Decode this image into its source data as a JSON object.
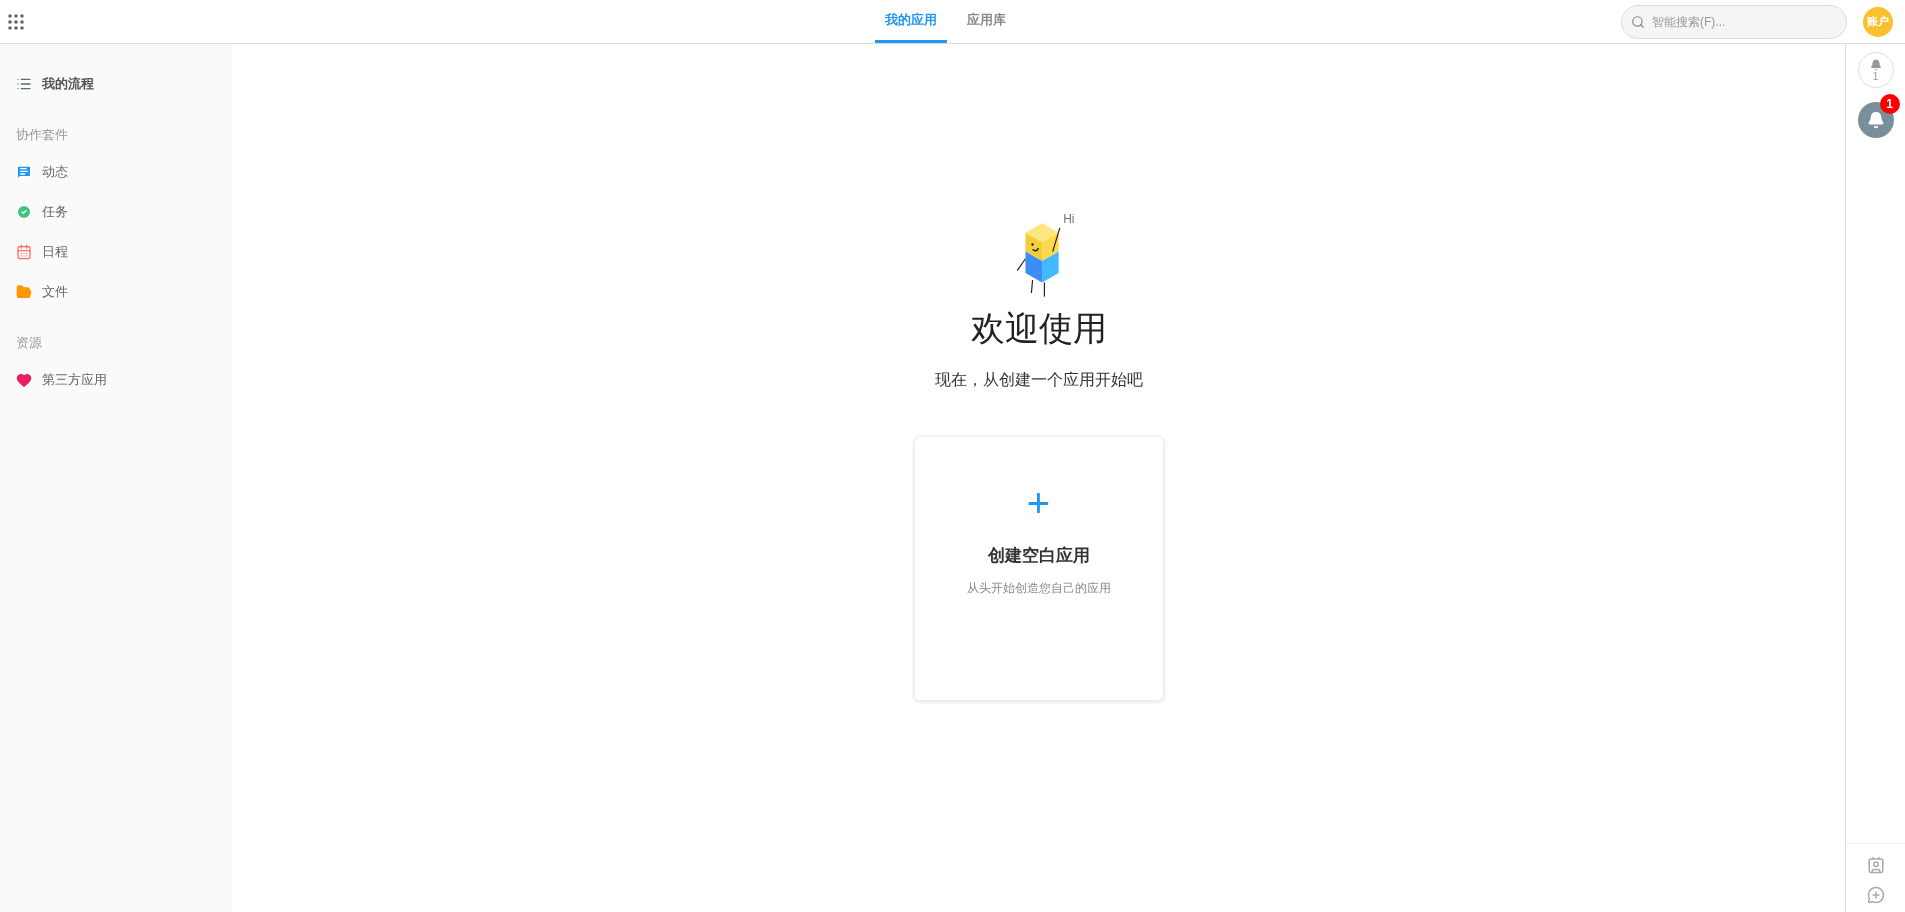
{
  "header": {
    "tabs": [
      {
        "label": "我的应用",
        "selected": true
      },
      {
        "label": "应用库",
        "selected": false
      }
    ],
    "search": {
      "placeholder": "智能搜索(F)..."
    },
    "account": "账户"
  },
  "sidebar": {
    "top_item": {
      "label": "我的流程"
    },
    "sections": [
      {
        "title": "协作套件",
        "items": [
          {
            "label": "动态"
          },
          {
            "label": "任务"
          },
          {
            "label": "日程"
          },
          {
            "label": "文件"
          }
        ]
      },
      {
        "title": "资源",
        "items": [
          {
            "label": "第三方应用"
          }
        ]
      }
    ]
  },
  "main": {
    "greeting": "Hi",
    "title": "欢迎使用",
    "subtitle": "现在，从创建一个应用开始吧",
    "card": {
      "plus": "+",
      "title": "创建空白应用",
      "description": "从头开始创造您自己的应用"
    }
  },
  "right_rail": {
    "notification_count": "1",
    "badge": "1"
  }
}
